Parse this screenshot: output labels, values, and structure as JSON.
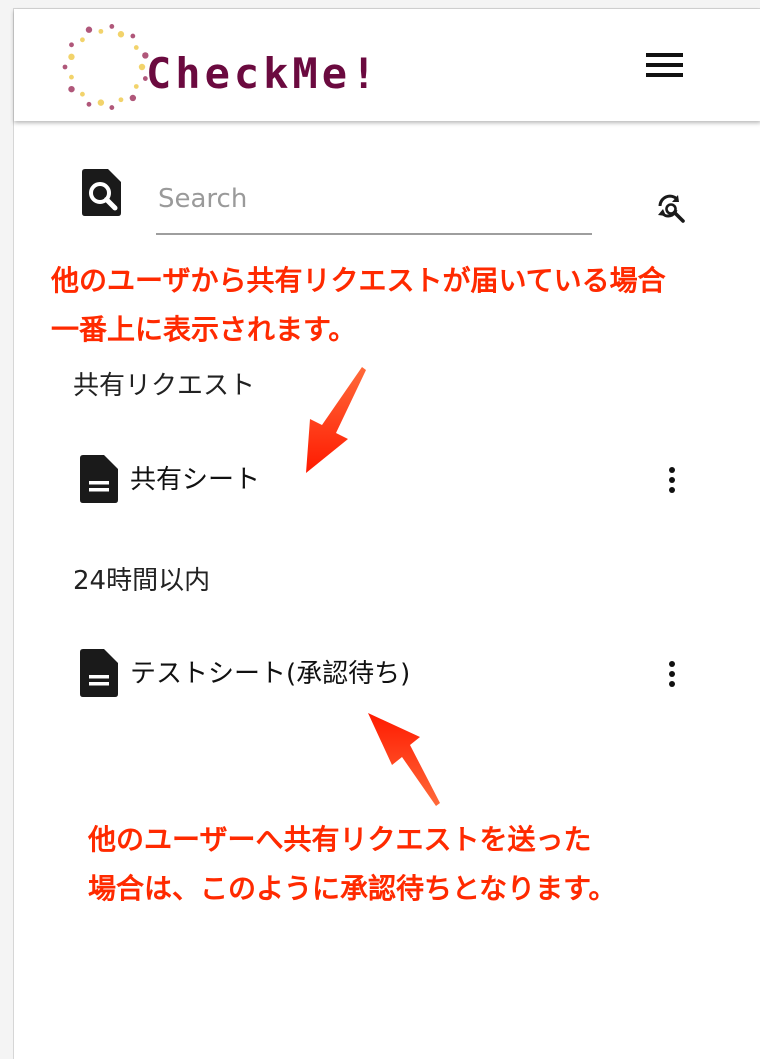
{
  "header": {
    "logo_text": "CheckMe!",
    "logo_alt": "CheckMe! logo",
    "menu_label": "menu"
  },
  "search": {
    "placeholder": "Search",
    "value": ""
  },
  "annotations": {
    "top": [
      "他のユーザから共有リクエストが届いている場合",
      "一番上に表示されます。"
    ],
    "bottom": [
      "他のユーザーへ共有リクエストを送った",
      "場合は、このように承認待ちとなります。"
    ]
  },
  "sections": {
    "shared": {
      "header": "共有リクエスト",
      "items": [
        {
          "label": "共有シート",
          "icon": "document-icon"
        }
      ]
    },
    "recent": {
      "header": "24時間以内",
      "items": [
        {
          "label": "テストシート(承認待ち)",
          "icon": "document-icon"
        }
      ]
    }
  },
  "colors": {
    "annotation": "#ff2a00",
    "logo_text": "#6b0a3f",
    "logo_dot_gold": "#f2d36b",
    "logo_dot_maroon": "#b0577a"
  }
}
